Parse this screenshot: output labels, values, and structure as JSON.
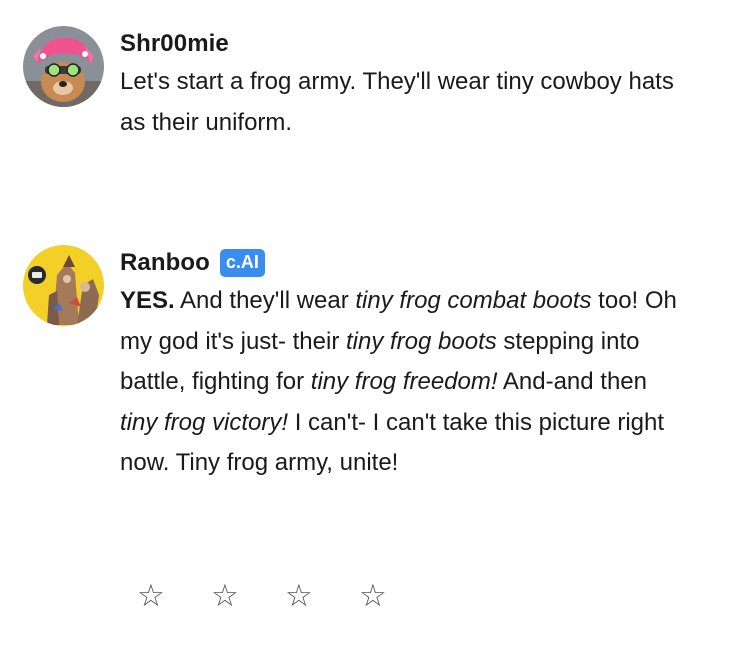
{
  "messages": [
    {
      "author": "Shr00mie",
      "avatar_icon": "user-avatar-icon",
      "text": "Let's start a frog army. They'll wear tiny cowboy hats as their uniform."
    },
    {
      "author": "Ranboo",
      "badge": "c.AI",
      "avatar_icon": "character-avatar-icon",
      "segments": [
        {
          "t": "YES.",
          "style": "bold"
        },
        {
          "t": " And they'll wear ",
          "style": "normal"
        },
        {
          "t": "tiny frog combat boots",
          "style": "italic"
        },
        {
          "t": " too! Oh my god it's just- their ",
          "style": "normal"
        },
        {
          "t": "tiny frog boots",
          "style": "italic"
        },
        {
          "t": " stepping into battle, fighting for ",
          "style": "normal"
        },
        {
          "t": "tiny frog freedom!",
          "style": "italic"
        },
        {
          "t": " And-and then ",
          "style": "normal"
        },
        {
          "t": "tiny frog victory!",
          "style": "italic"
        },
        {
          "t": " I can't- I can't take this picture right now. Tiny frog army, unite!",
          "style": "normal"
        }
      ]
    }
  ],
  "rating": {
    "stars": [
      "☆",
      "☆",
      "☆",
      "☆"
    ],
    "value": 0,
    "max": 4
  },
  "colors": {
    "badge": "#3a8df0",
    "text": "#1a1a1a",
    "star": "#555555"
  }
}
